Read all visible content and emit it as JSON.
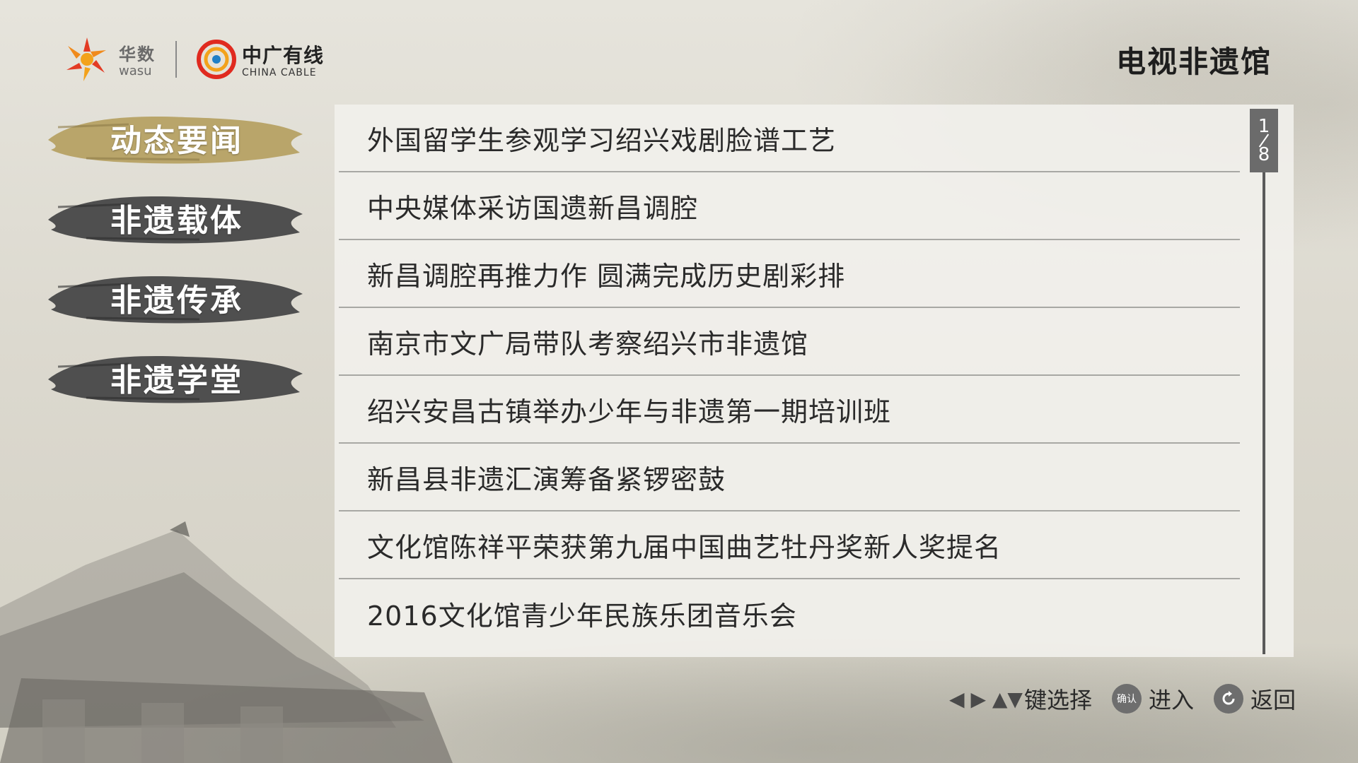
{
  "header": {
    "wasu": {
      "cn": "华数",
      "en": "wasu"
    },
    "cable": {
      "cn": "中广有线",
      "en": "CHINA CABLE"
    },
    "title": "电视非遗馆"
  },
  "nav": {
    "items": [
      {
        "label": "动态要闻",
        "active": true
      },
      {
        "label": "非遗载体",
        "active": false
      },
      {
        "label": "非遗传承",
        "active": false
      },
      {
        "label": "非遗学堂",
        "active": false
      }
    ]
  },
  "list": {
    "items": [
      "外国留学生参观学习绍兴戏剧脸谱工艺",
      "中央媒体采访国遗新昌调腔",
      "新昌调腔再推力作 圆满完成历史剧彩排",
      "南京市文广局带队考察绍兴市非遗馆",
      "绍兴安昌古镇举办少年与非遗第一期培训班",
      "新昌县非遗汇演筹备紧锣密鼓",
      "文化馆陈祥平荣获第九届中国曲艺牡丹奖新人奖提名",
      "2016文化馆青少年民族乐团音乐会"
    ],
    "page_current": "1",
    "page_total": "8"
  },
  "hints": {
    "arrows": "◀ ▶ ▲▼",
    "select_label": "键选择",
    "ok_button": "确认",
    "enter_label": "进入",
    "back_label": "返回"
  },
  "colors": {
    "nav_active": "#b9a56a",
    "nav_inactive": "#4f4f4f",
    "title_text": "#1e1e1e"
  }
}
